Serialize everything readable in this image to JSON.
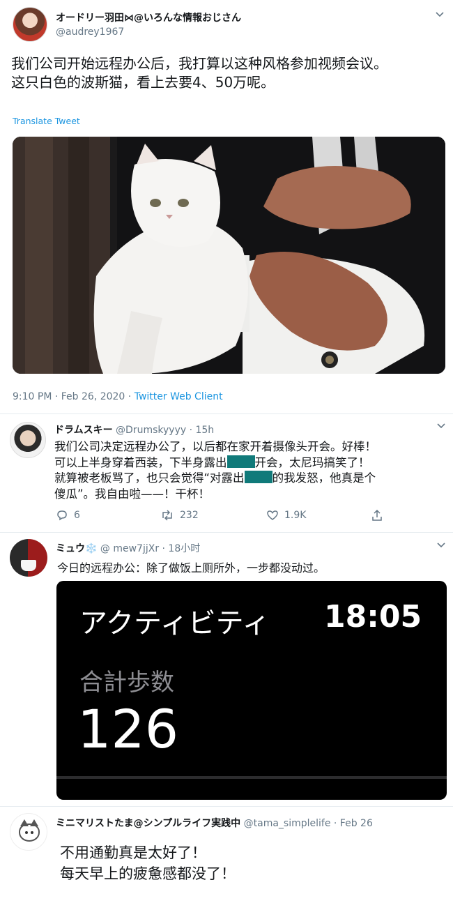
{
  "tweet1": {
    "display_name": "オードリー羽田⋈@いろんな情報おじさん",
    "handle": "@audrey1967",
    "text_line1": "我们公司开始远程办公后，我打算以这种风格参加视频会议。",
    "text_line2": "这只白色的波斯猫，看上去要4、50万呢。",
    "translate": "Translate Tweet",
    "timestamp": "9:10 PM · Feb 26, 2020 ·",
    "client": "Twitter Web Client"
  },
  "tweet2": {
    "display_name": "ドラムスキー",
    "handle": "@Drumskyyyy",
    "time": "· 15h",
    "line1": "我们公司决定远程办公了，以后都在家开着摄像头开会。好棒！",
    "line2a": "可以上半身穿着西装，下半身露出",
    "line2b": "开会，太尼玛搞笑了！",
    "line3a": "就算被老板骂了，也只会觉得“对露出",
    "line3b": "的我发怒，他真是个",
    "line4": "傻瓜”。我自由啦——！干杯！",
    "replies": "6",
    "retweets": "232",
    "likes": "1.9K"
  },
  "tweet3": {
    "display_name": "ミュウ❄️",
    "handle": "@ mew7jjXr",
    "time": "· 18小时",
    "text": "今日的远程办公：除了做饭上厕所外，一步都没动过。",
    "screen_title": "アクティビティ",
    "screen_time": "18:05",
    "screen_label": "合計歩数",
    "screen_steps": "126"
  },
  "tweet4": {
    "display_name": "ミニマリストたま@シンプルライフ実践中",
    "handle": "@tama_simplelife",
    "time": "· Feb 26",
    "line1": "不用通勤真是太好了！",
    "line2": "每天早上的疲惫感都没了！"
  },
  "colors": {
    "link": "#1b95e0",
    "muted": "#657786",
    "redaction": "#107a7a"
  }
}
